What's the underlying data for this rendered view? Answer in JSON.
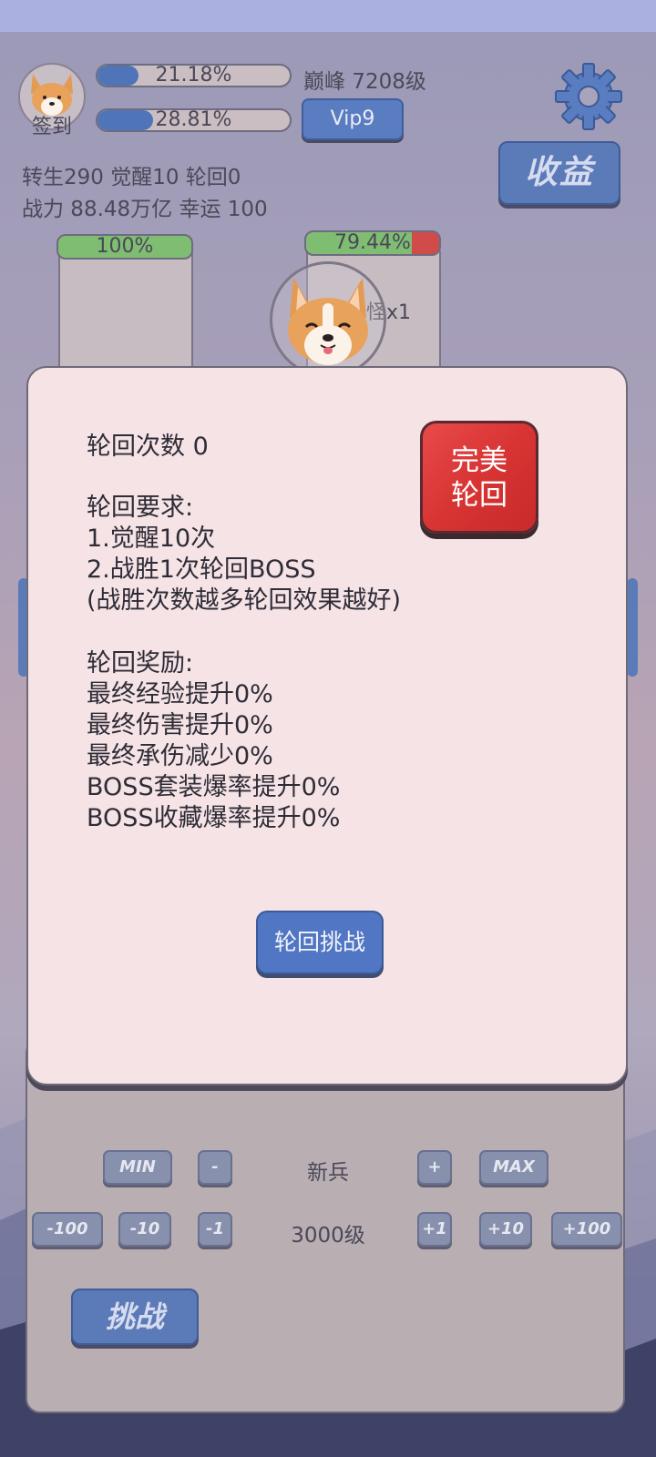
{
  "header": {
    "checkin_label": "签到",
    "exp_bar": {
      "text": "21.18%",
      "progress": 0.2118
    },
    "second_bar": {
      "text": "28.81%",
      "progress": 0.2881
    },
    "peak_label": "巅峰 7208级",
    "vip_label": "Vip9",
    "income_label": "收益",
    "stats_line1": "转生290 觉醒10 轮回0",
    "stats_line2": "战力 88.48万亿  幸运 100"
  },
  "battle": {
    "player_hp": {
      "text": "100%",
      "progress": 1.0
    },
    "monster_hp": {
      "text": "79.44%",
      "progress": 0.7944
    },
    "monster_label": "怪x1"
  },
  "modal": {
    "count_line": "轮回次数 0",
    "req_title": "轮回要求:",
    "req_1": "1.觉醒10次",
    "req_2": "2.战胜1次轮回BOSS",
    "req_note": "(战胜次数越多轮回效果越好)",
    "reward_title": "轮回奖励:",
    "reward_1": "最终经验提升0%",
    "reward_2": "最终伤害提升0%",
    "reward_3": "最终承伤减少0%",
    "reward_4": "BOSS套装爆率提升0%",
    "reward_5": "BOSS收藏爆率提升0%",
    "perfect_line1": "完美",
    "perfect_line2": "轮回",
    "challenge_button": "轮回挑战"
  },
  "level_panel": {
    "min_label": "MIN",
    "minus_label": "-",
    "rank_label": "新兵",
    "plus_label": "+",
    "max_label": "MAX",
    "m100": "-100",
    "m10": "-10",
    "m1": "-1",
    "level_label": "3000级",
    "p1": "+1",
    "p10": "+10",
    "p100": "+100",
    "challenge_label": "挑战"
  },
  "colors": {
    "accent_blue": "#5176c4",
    "danger_red": "#e94a4a",
    "hp_green": "#7fbd72"
  },
  "icons": [
    "corgi-avatar-icon",
    "gear-icon",
    "corgi-monster-icon"
  ]
}
